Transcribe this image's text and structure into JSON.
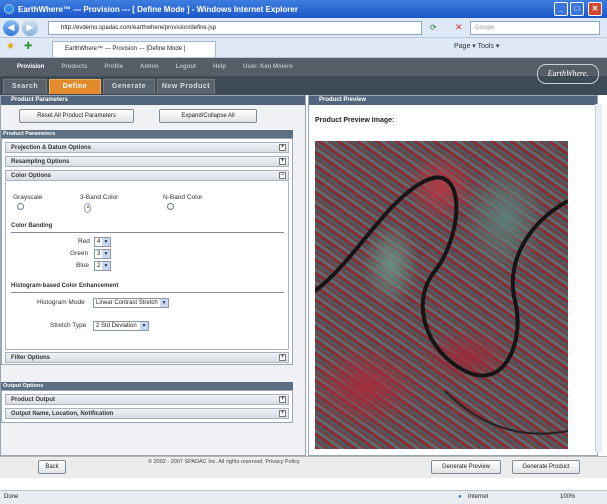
{
  "window": {
    "title": "EarthWhere™ --- Provision --- [ Define Mode ]      - Windows Internet Explorer"
  },
  "browser": {
    "url": "http://evdemo.spadac.com/earthwhere/provision/define.jsp",
    "search_placeholder": "Google",
    "tab_title": "EarthWhere™ --- Provision --- [Define Mode ]",
    "tools": "Page ▾  Tools ▾"
  },
  "app": {
    "nav": [
      "Provision",
      "Products",
      "Profile",
      "Admin",
      "Logout",
      "Help",
      "User: Ken Molero"
    ],
    "tabs": [
      "Search",
      "Define",
      "Generate",
      "New Product"
    ],
    "logo": "EarthWhere."
  },
  "left": {
    "header": "Product Parameters",
    "reset_label": "Reset All Product Parameters",
    "expand_label": "Expand/Collapse All",
    "group_params": "Product Parameters",
    "sections": [
      "Projection & Datum Options",
      "Resampling Options",
      "Color Options"
    ],
    "color": {
      "grayscale": "Grayscale",
      "three_band": "3-Band Color",
      "n_band": "N-Band Color",
      "banding_title": "Color Banding",
      "red_label": "Red",
      "red_value": "4",
      "green_label": "Green",
      "green_value": "3",
      "blue_label": "Blue",
      "blue_value": "2",
      "hist_title": "Histogram-based Color Enhancement",
      "hist_mode_label": "Histogram Mode",
      "hist_mode_value": "Linear Contrast Stretch",
      "stretch_label": "Stretch Type",
      "stretch_value": "2 Std Deviation"
    },
    "filter_section": "Filter Options",
    "group_output": "Output Options",
    "output_sections": [
      "Product Output",
      "Output Name, Location, Notification"
    ]
  },
  "right": {
    "header": "Product Preview",
    "preview_title": "Product Preview Image:"
  },
  "footer": {
    "back": "Back",
    "copyright": "© 2002 - 2007 SPADAC Inc. All rights reserved. Privacy Policy",
    "generate_preview": "Generate Preview",
    "generate_product": "Generate Product"
  },
  "status": {
    "left": "Done",
    "zone": "Internet",
    "zoom": "100%"
  }
}
